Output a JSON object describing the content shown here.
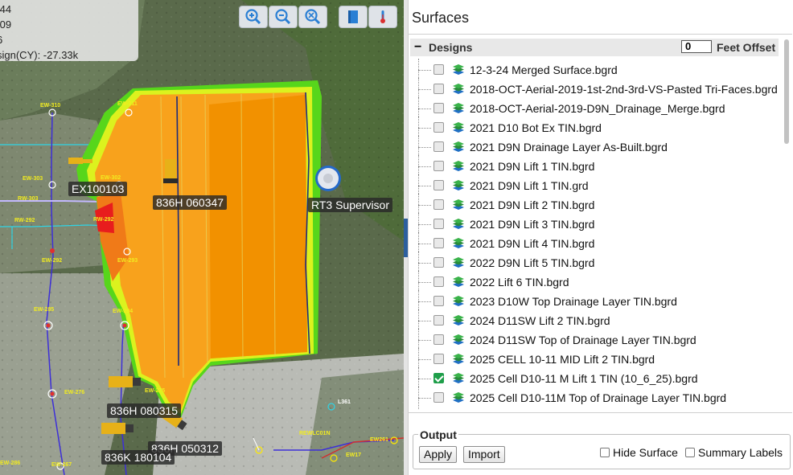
{
  "map": {
    "info_lines": [
      ".44",
      ".09",
      "6",
      "sign(CY):   -27.33k"
    ],
    "toolbar_icons": [
      "zoom-in-icon",
      "zoom-out-icon",
      "zoom-extents-icon",
      "layers-book-icon",
      "temperature-icon"
    ],
    "equipment_labels": [
      "EX100103",
      "836H 060347",
      "RT3 Supervisor",
      "836H 080315",
      "836H 050312",
      "836K 180104"
    ],
    "point_labels": [
      "EW-310",
      "EW-311",
      "EW-303",
      "EW-302",
      "RW-303",
      "RW-292",
      "EW-292",
      "EW-293",
      "EW-295",
      "EW-294",
      "EW-276",
      "EW-275",
      "REWLC01N",
      "EW261",
      "EW17",
      "EW-286",
      "EW-267",
      "EW-287",
      "L361"
    ],
    "colors": {
      "cut_fill": "#f8a21c",
      "cut_fill_dark": "#f29100",
      "edge_green": "#57d61b",
      "edge_yellow": "#dcf21e"
    }
  },
  "panel": {
    "title": "Surfaces",
    "group": {
      "name": "Designs",
      "offset_value": "0",
      "offset_label": "Feet Offset"
    },
    "items": [
      {
        "name": "12-3-24 Merged Surface.bgrd",
        "checked": false
      },
      {
        "name": "2018-OCT-Aerial-2019-1st-2nd-3rd-VS-Pasted Tri-Faces.bgrd",
        "checked": false
      },
      {
        "name": "2018-OCT-Aerial-2019-D9N_Drainage_Merge.bgrd",
        "checked": false
      },
      {
        "name": "2021 D10 Bot Ex TIN.bgrd",
        "checked": false
      },
      {
        "name": "2021 D9N Drainage Layer As-Built.bgrd",
        "checked": false
      },
      {
        "name": "2021 D9N Lift 1 TIN.bgrd",
        "checked": false
      },
      {
        "name": "2021 D9N Lift 1 TIN.grd",
        "checked": false
      },
      {
        "name": "2021 D9N Lift 2 TIN.bgrd",
        "checked": false
      },
      {
        "name": "2021 D9N Lift 3 TIN.bgrd",
        "checked": false
      },
      {
        "name": "2021 D9N Lift 4 TIN.bgrd",
        "checked": false
      },
      {
        "name": "2022 D9N Lift 5 TIN.bgrd",
        "checked": false
      },
      {
        "name": "2022 Lift 6 TIN.bgrd",
        "checked": false
      },
      {
        "name": "2023 D10W Top Drainage Layer TIN.bgrd",
        "checked": false
      },
      {
        "name": "2024 D11SW Lift 2 TIN.bgrd",
        "checked": false
      },
      {
        "name": "2024 D11SW Top of Drainage Layer TIN.bgrd",
        "checked": false
      },
      {
        "name": "2025 CELL 10-11 MID Lift 2 TIN.bgrd",
        "checked": false
      },
      {
        "name": "2025 Cell D10-11 M Lift 1 TIN (10_6_25).bgrd",
        "checked": true
      },
      {
        "name": "2025 Cell D10-11M Top of Drainage Layer TIN.bgrd",
        "checked": false
      }
    ],
    "output": {
      "legend": "Output",
      "apply_label": "Apply",
      "import_label": "Import",
      "hide_surface_label": "Hide Surface",
      "summary_labels_label": "Summary Labels"
    }
  }
}
